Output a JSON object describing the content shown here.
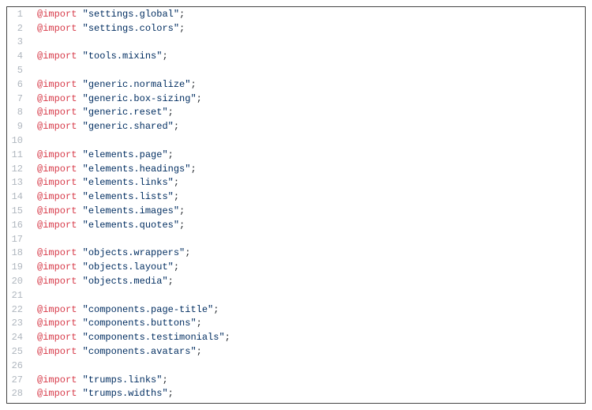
{
  "lines": [
    {
      "n": 1,
      "kw": "@import",
      "s": "\"settings.global\"",
      "p": ";"
    },
    {
      "n": 2,
      "kw": "@import",
      "s": "\"settings.colors\"",
      "p": ";"
    },
    {
      "n": 3,
      "kw": "",
      "s": "",
      "p": ""
    },
    {
      "n": 4,
      "kw": "@import",
      "s": "\"tools.mixins\"",
      "p": ";"
    },
    {
      "n": 5,
      "kw": "",
      "s": "",
      "p": ""
    },
    {
      "n": 6,
      "kw": "@import",
      "s": "\"generic.normalize\"",
      "p": ";"
    },
    {
      "n": 7,
      "kw": "@import",
      "s": "\"generic.box-sizing\"",
      "p": ";"
    },
    {
      "n": 8,
      "kw": "@import",
      "s": "\"generic.reset\"",
      "p": ";"
    },
    {
      "n": 9,
      "kw": "@import",
      "s": "\"generic.shared\"",
      "p": ";"
    },
    {
      "n": 10,
      "kw": "",
      "s": "",
      "p": ""
    },
    {
      "n": 11,
      "kw": "@import",
      "s": "\"elements.page\"",
      "p": ";"
    },
    {
      "n": 12,
      "kw": "@import",
      "s": "\"elements.headings\"",
      "p": ";"
    },
    {
      "n": 13,
      "kw": "@import",
      "s": "\"elements.links\"",
      "p": ";"
    },
    {
      "n": 14,
      "kw": "@import",
      "s": "\"elements.lists\"",
      "p": ";"
    },
    {
      "n": 15,
      "kw": "@import",
      "s": "\"elements.images\"",
      "p": ";"
    },
    {
      "n": 16,
      "kw": "@import",
      "s": "\"elements.quotes\"",
      "p": ";"
    },
    {
      "n": 17,
      "kw": "",
      "s": "",
      "p": ""
    },
    {
      "n": 18,
      "kw": "@import",
      "s": "\"objects.wrappers\"",
      "p": ";"
    },
    {
      "n": 19,
      "kw": "@import",
      "s": "\"objects.layout\"",
      "p": ";"
    },
    {
      "n": 20,
      "kw": "@import",
      "s": "\"objects.media\"",
      "p": ";"
    },
    {
      "n": 21,
      "kw": "",
      "s": "",
      "p": ""
    },
    {
      "n": 22,
      "kw": "@import",
      "s": "\"components.page-title\"",
      "p": ";"
    },
    {
      "n": 23,
      "kw": "@import",
      "s": "\"components.buttons\"",
      "p": ";"
    },
    {
      "n": 24,
      "kw": "@import",
      "s": "\"components.testimonials\"",
      "p": ";"
    },
    {
      "n": 25,
      "kw": "@import",
      "s": "\"components.avatars\"",
      "p": ";"
    },
    {
      "n": 26,
      "kw": "",
      "s": "",
      "p": ""
    },
    {
      "n": 27,
      "kw": "@import",
      "s": "\"trumps.links\"",
      "p": ";"
    },
    {
      "n": 28,
      "kw": "@import",
      "s": "\"trumps.widths\"",
      "p": ";"
    }
  ]
}
